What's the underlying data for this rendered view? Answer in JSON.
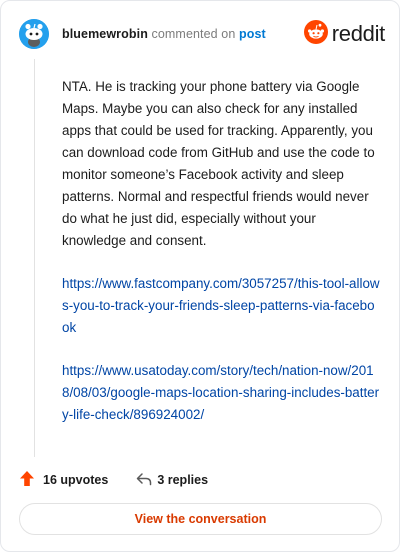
{
  "header": {
    "username": "bluemewrobin",
    "verb": "commented on",
    "link_text": "post",
    "brand": "reddit",
    "avatar_icon": "snoo-avatar-icon",
    "brand_icon": "reddit-logo-icon"
  },
  "comment": {
    "paragraphs": [
      "NTA. He is tracking your phone battery via Google Maps. Maybe you can also check for any installed apps that could be used for tracking. Apparently, you can download code from GitHub and use the code to monitor someone’s Facebook activity and sleep patterns. Normal and respectful friends would never do what he just did, especially without your knowledge and consent."
    ],
    "links": [
      "https://www.fastcompany.com/3057257/this-tool-allows-you-to-track-your-friends-sleep-patterns-via-facebook",
      "https://www.usatoday.com/story/tech/nation-now/2018/08/03/google-maps-location-sharing-includes-battery-life-check/896924002/"
    ]
  },
  "footer": {
    "upvotes": "16 upvotes",
    "replies": "3 replies",
    "upvote_icon": "upvote-arrow-icon",
    "reply_icon": "reply-arrow-icon"
  },
  "cta": {
    "label": "View the conversation"
  },
  "colors": {
    "brand": "#ff4500",
    "link": "#0045a5",
    "post_link": "#0079d3",
    "cta_text": "#d93a00",
    "avatar_bg": "#24a0ed"
  }
}
